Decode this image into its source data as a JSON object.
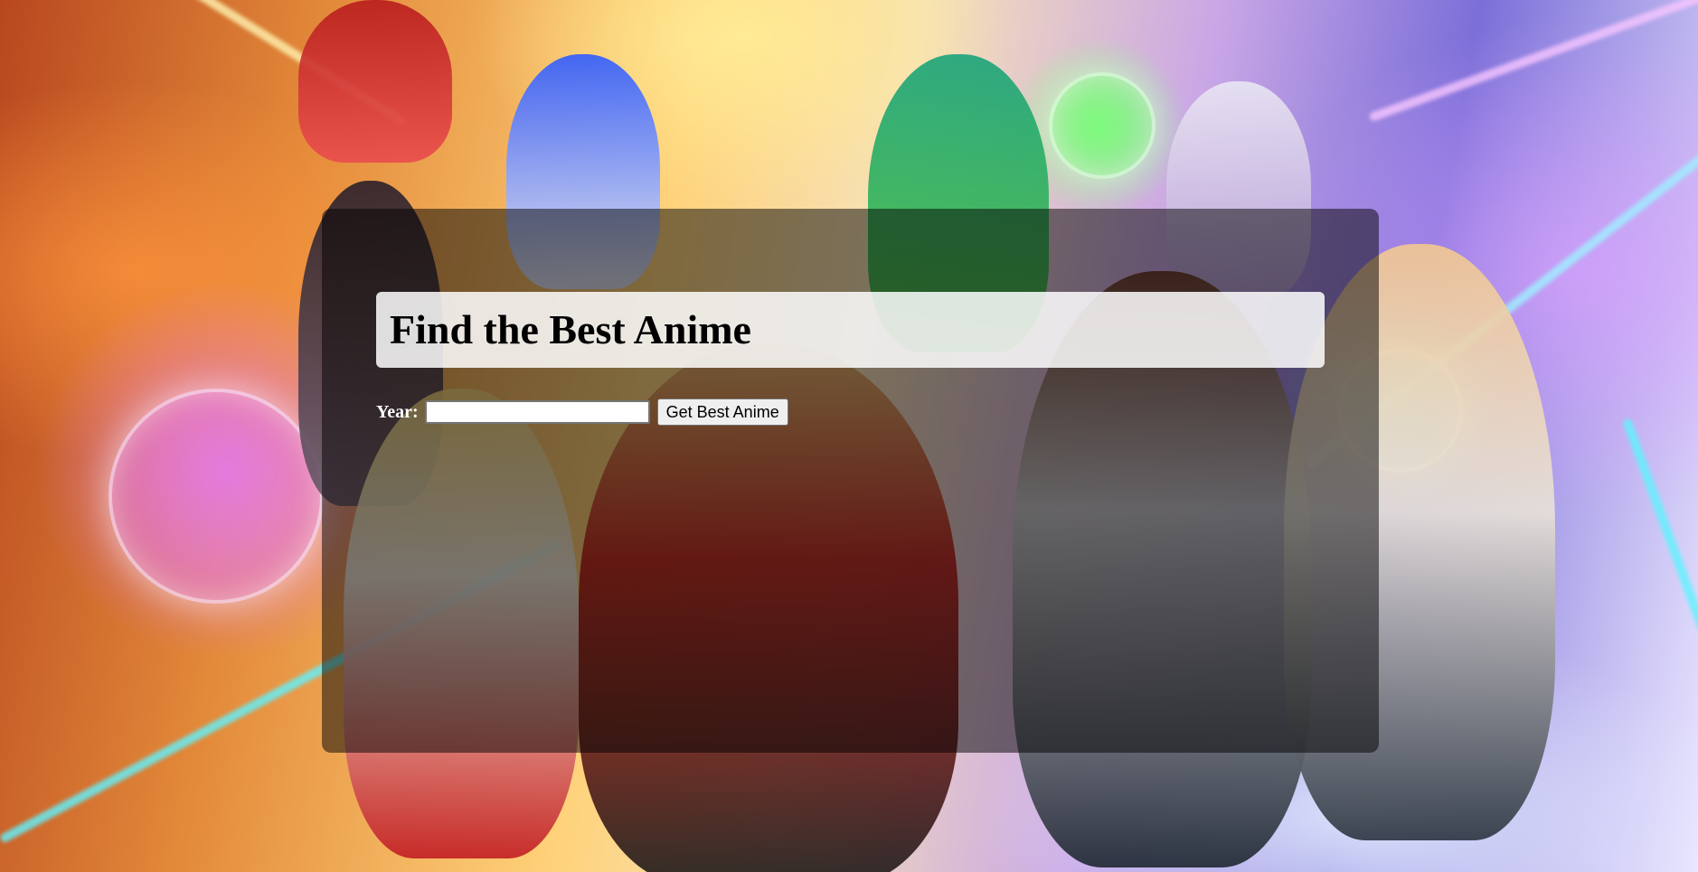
{
  "page": {
    "title": "Find the Best Anime",
    "background_image": "anime-heroes-artwork"
  },
  "form": {
    "year_label": "Year:",
    "year_value": "",
    "year_placeholder": "",
    "submit_label": "Get Best Anime"
  },
  "colors": {
    "panel_overlay": "#00000080",
    "heading_box": "#ffffffd9",
    "label_text": "#ffffff",
    "button_bg": "#efefef"
  }
}
